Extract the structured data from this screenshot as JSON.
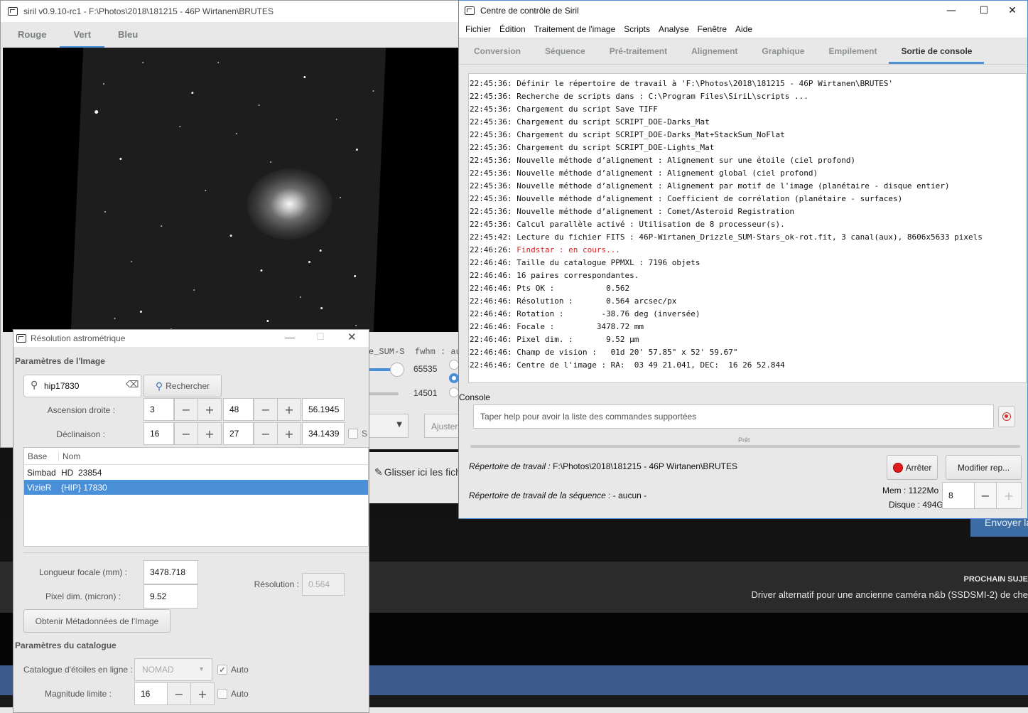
{
  "main_window": {
    "title": "siril v0.9.10-rc1 - F:\\Photos\\2018\\181215 - 46P Wirtanen\\BRUTES",
    "channel_tabs": [
      "Rouge",
      "Vert",
      "Bleu"
    ],
    "active_channel": "Vert",
    "partial": {
      "sum_label": "e_SUM-S",
      "fwhm_label": "fwhm : auc",
      "hi_value": "65535",
      "lo_value": "14501",
      "adjust_label": "Ajuster",
      "drop_label": "Glisser ici les fichie"
    }
  },
  "control_center": {
    "title": "Centre de contrôle de Siril",
    "window_controls": [
      "—",
      "☐",
      "✕"
    ],
    "menu": [
      "Fichier",
      "Édition",
      "Traitement de l'image",
      "Scripts",
      "Analyse",
      "Fenêtre",
      "Aide"
    ],
    "tabs": [
      "Conversion",
      "Séquence",
      "Pré-traitement",
      "Alignement",
      "Graphique",
      "Empilement",
      "Sortie de console"
    ],
    "active_tab": "Sortie de console",
    "log": [
      {
        "time": "22:45:36:",
        "text": "Définir le répertoire de travail à 'F:\\Photos\\2018\\181215 - 46P Wirtanen\\BRUTES'"
      },
      {
        "time": "22:45:36:",
        "text": "Recherche de scripts dans : C:\\Program Files\\SiriL\\scripts ..."
      },
      {
        "time": "22:45:36:",
        "text": "Chargement du script Save TIFF"
      },
      {
        "time": "22:45:36:",
        "text": "Chargement du script SCRIPT_DOE-Darks_Mat"
      },
      {
        "time": "22:45:36:",
        "text": "Chargement du script SCRIPT_DOE-Darks_Mat+StackSum_NoFlat"
      },
      {
        "time": "22:45:36:",
        "text": "Chargement du script SCRIPT_DOE-Lights_Mat"
      },
      {
        "time": "22:45:36:",
        "text": "Nouvelle méthode d’alignement : Alignement sur une étoile (ciel profond)"
      },
      {
        "time": "22:45:36:",
        "text": "Nouvelle méthode d’alignement : Alignement global (ciel profond)"
      },
      {
        "time": "22:45:36:",
        "text": "Nouvelle méthode d’alignement : Alignement par motif de l'image (planétaire - disque entier)"
      },
      {
        "time": "22:45:36:",
        "text": "Nouvelle méthode d’alignement : Coefficient de corrélation (planétaire - surfaces)"
      },
      {
        "time": "22:45:36:",
        "text": "Nouvelle méthode d’alignement : Comet/Asteroid Registration"
      },
      {
        "time": "22:45:36:",
        "text": "Calcul parallèle activé : Utilisation de 8 processeur(s)."
      },
      {
        "time": "22:45:42:",
        "text": "Lecture du fichier FITS : 46P-Wirtanen_Drizzle_SUM-Stars_ok-rot.fit, 3 canal(aux), 8606x5633 pixels"
      },
      {
        "time": "22:46:26:",
        "text": "Findstar : en cours...",
        "red": true
      },
      {
        "time": "22:46:46:",
        "text": "Taille du catalogue PPMXL : 7196 objets"
      },
      {
        "time": "22:46:46:",
        "text": "16 paires correspondantes."
      },
      {
        "time": "22:46:46:",
        "text": "Pts OK :           0.562"
      },
      {
        "time": "22:46:46:",
        "text": "Résolution :       0.564 arcsec/px"
      },
      {
        "time": "22:46:46:",
        "text": "Rotation :        -38.76 deg (inversée)"
      },
      {
        "time": "22:46:46:",
        "text": "Focale :         3478.72 mm"
      },
      {
        "time": "22:46:46:",
        "text": "Pixel dim. :       9.52 µm"
      },
      {
        "time": "22:46:46:",
        "text": "Champ de vision :   01d 20' 57.85\" x 52' 59.67\""
      },
      {
        "time": "22:46:46:",
        "text": "Centre de l'image : RA:  03 49 21.041, DEC:  16 26 52.844"
      }
    ],
    "console_label": "Console",
    "command_placeholder": "Taper help pour avoir la liste des commandes supportées",
    "progress_text": "Prêt",
    "progress_fraction": 0,
    "workdir_label": "Répertoire de travail :",
    "workdir_value": " F:\\Photos\\2018\\181215 - 46P Wirtanen\\BRUTES",
    "seq_label": "Répertoire de travail de la séquence :",
    "seq_value": " - aucun -",
    "stop_button": "Arrêter",
    "modify_button": "Modifier rep...",
    "mem": "Mem : 1122Mo",
    "disk": "Disque : 494G",
    "threads": "8"
  },
  "astrometry": {
    "title": "Résolution astrométrique",
    "image_params_label": "Paramètres de l'Image",
    "search_value": "hip17830",
    "search_button": "Rechercher",
    "ra_label": "Ascension droite :",
    "ra": {
      "h": "3",
      "m": "48",
      "s": "56.1945"
    },
    "dec_label": "Déclinaison :",
    "dec": {
      "d": "16",
      "m": "27",
      "s": "34.1439"
    },
    "south_label": "S",
    "list_headers": [
      "Base",
      "Nom"
    ],
    "results": [
      {
        "base": "Simbad",
        "name": "HD  23854",
        "selected": false
      },
      {
        "base": "VizieR",
        "name": "{HIP} 17830",
        "selected": true
      }
    ],
    "focal_label": "Longueur focale (mm) :",
    "focal_value": "3478.718",
    "pixel_label": "Pixel dim. (micron) :",
    "pixel_value": "9.52",
    "resolution_label": "Résolution :",
    "resolution_value": "0.564",
    "metadata_button": "Obtenir Métadonnées de l'Image",
    "catalog_params_label": "Paramètres du catalogue",
    "catalog_label": "Catalogue d'étoiles en ligne :",
    "catalog_value": "NOMAD",
    "auto_label": "Auto",
    "mag_label": "Magnitude limite :",
    "mag_value": "16",
    "auto2_label": "Auto"
  },
  "background_page": {
    "send_button": "Envoyer la",
    "next_topic_title": "PROCHAIN SUJE",
    "next_topic_text": "Driver alternatif pour une ancienne caméra n&b (SSDSMI-2) de che"
  },
  "colors": {
    "accent": "#4a90d9",
    "selection": "#4a90d9",
    "error_text": "#e02020",
    "forum_band": "#3c5b8c"
  }
}
